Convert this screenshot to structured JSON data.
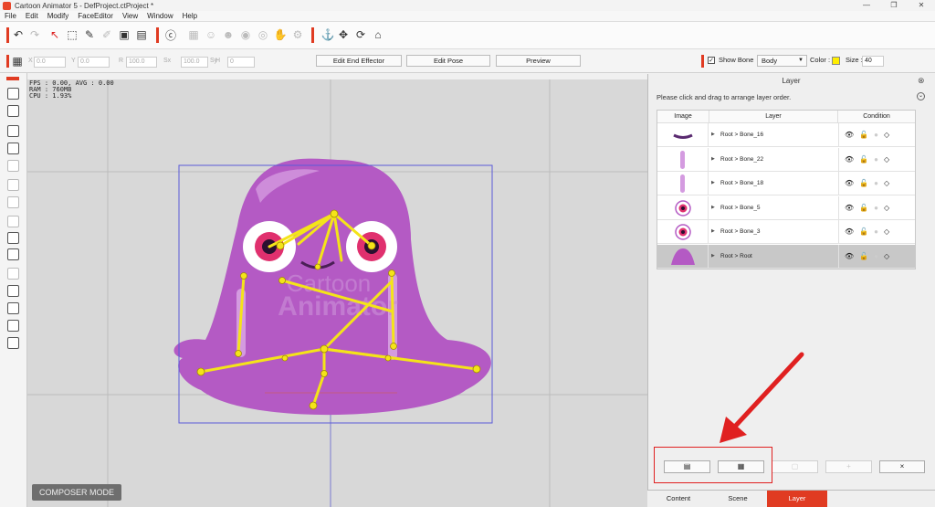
{
  "window": {
    "title": "Cartoon Animator 5 - DefProject.ctProject *"
  },
  "menu": [
    "File",
    "Edit",
    "Modify",
    "FaceEditor",
    "View",
    "Window",
    "Help"
  ],
  "transform": {
    "x": "0.0",
    "y": "0.0",
    "rotation": "100.0",
    "scale_x": "100.0",
    "scale_y": "100.0",
    "flip": "0",
    "labels": [
      "X",
      "Y",
      "R",
      "Sx",
      "Sy",
      "H"
    ]
  },
  "toolbar": {
    "edit_end_effector": "Edit End Effector",
    "edit_pose": "Edit Pose",
    "preview": "Preview",
    "show_bone": "Show Bone",
    "bone_select": "Body",
    "color_label": "Color :",
    "color_value": "#ffee00",
    "size_label": "Size :",
    "size_value": "40"
  },
  "stats": "FPS : 0.00, AVG : 0.00\nRAM : 760MB\nCPU : 1.93%",
  "watermark": "Cartoon\nAnimator",
  "mode_label": "COMPOSER MODE",
  "panel": {
    "title": "Layer",
    "hint": "Please click and drag to arrange layer order.",
    "columns": [
      "Image",
      "Layer",
      "Condition"
    ],
    "rows": [
      {
        "layer": "Root > Bone_16",
        "thumb": "mouth",
        "selected": false
      },
      {
        "layer": "Root > Bone_22",
        "thumb": "tear",
        "selected": false
      },
      {
        "layer": "Root > Bone_18",
        "thumb": "tear",
        "selected": false
      },
      {
        "layer": "Root > Bone_5",
        "thumb": "eye",
        "selected": false
      },
      {
        "layer": "Root > Bone_3",
        "thumb": "eye",
        "selected": false
      },
      {
        "layer": "Root > Root",
        "thumb": "body",
        "selected": true
      }
    ],
    "bottom_buttons": [
      "add-image-icon",
      "add-sprite-icon",
      "link-icon",
      "plus-icon",
      "×"
    ]
  },
  "tabs": [
    {
      "label": "Content",
      "active": false
    },
    {
      "label": "Scene",
      "active": false
    },
    {
      "label": "Layer",
      "active": true
    }
  ],
  "colors": {
    "accent": "#e03b22",
    "body": "#b45ac4",
    "bone": "#f4e419",
    "annotation": "#e02020"
  }
}
